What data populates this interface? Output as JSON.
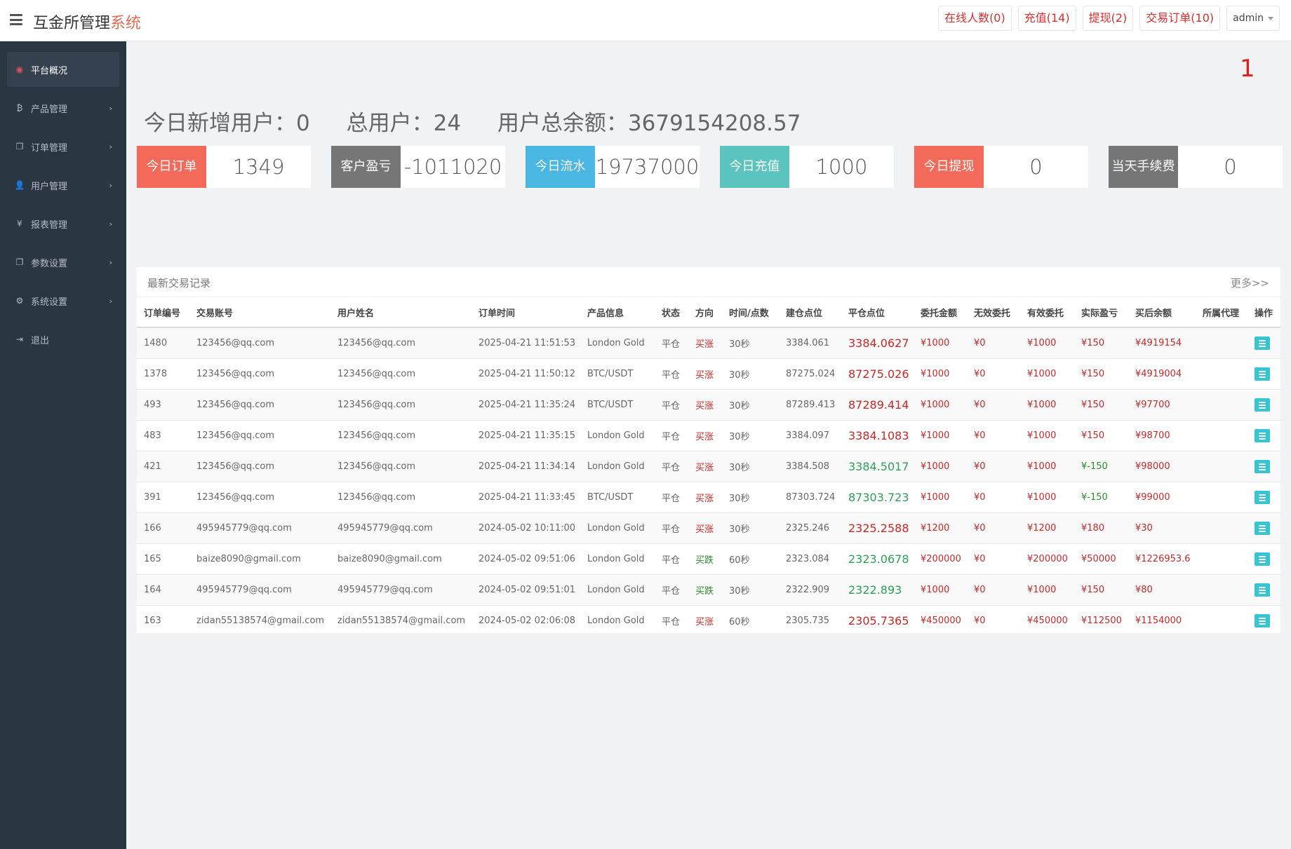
{
  "header": {
    "brand_main": "互金所管理",
    "brand_accent": "系统",
    "actions": [
      {
        "label": "在线人数(0)"
      },
      {
        "label": "充值(14)"
      },
      {
        "label": "提现(2)"
      },
      {
        "label": "交易订单(10)"
      }
    ],
    "user": "admin"
  },
  "sidebar": {
    "items": [
      {
        "label": "平台概况",
        "icon": "dashboard-icon",
        "glyph": "◉"
      },
      {
        "label": "产品管理",
        "icon": "bitcoin-icon",
        "glyph": "₿"
      },
      {
        "label": "订单管理",
        "icon": "copy-icon",
        "glyph": "❐"
      },
      {
        "label": "用户管理",
        "icon": "user-icon",
        "glyph": "👤"
      },
      {
        "label": "报表管理",
        "icon": "yen-icon",
        "glyph": "¥"
      },
      {
        "label": "参数设置",
        "icon": "copy-icon",
        "glyph": "❐"
      },
      {
        "label": "系统设置",
        "icon": "gears-icon",
        "glyph": "⚙"
      },
      {
        "label": "退出",
        "icon": "sign-out-icon",
        "glyph": "⇥"
      }
    ]
  },
  "badge_number": "1",
  "summary": {
    "new_users_label": "今日新增用户：",
    "new_users": "0",
    "total_users_label": "总用户：",
    "total_users": "24",
    "balance_label": "用户总余额：",
    "balance": "3679154208.57"
  },
  "stats": [
    {
      "label1": "今日",
      "label2": "订单",
      "value": "1349",
      "color": "#f36a5a"
    },
    {
      "label1": "客户",
      "label2": "盈亏",
      "value": "-1011020",
      "color": "#767676"
    },
    {
      "label1": "今日",
      "label2": "流水",
      "value": "19737000",
      "color": "#4ab6e2"
    },
    {
      "label1": "今日",
      "label2": "充值",
      "value": "1000",
      "color": "#5bc4bf"
    },
    {
      "label1": "今日",
      "label2": "提现",
      "value": "0",
      "color": "#f36a5a"
    },
    {
      "label1": "当天",
      "label2": "手续费",
      "value": "0",
      "color": "#767676"
    }
  ],
  "table": {
    "title": "最新交易记录",
    "more": "更多>>",
    "columns": [
      "订单编号",
      "交易账号",
      "用户姓名",
      "订单时间",
      "产品信息",
      "状态",
      "方向",
      "时间/点数",
      "建仓点位",
      "平仓点位",
      "委托金额",
      "无效委托",
      "有效委托",
      "实际盈亏",
      "买后余额",
      "所属代理",
      "操作"
    ],
    "rows": [
      {
        "id": "1480",
        "account": "123456@qq.com",
        "name": "123456@qq.com",
        "time": "2025-04-21 11:51:53",
        "product": "London Gold",
        "status": "平仓",
        "direction": "买涨",
        "duration": "30秒",
        "open": "3384.061",
        "close": "3384.0627",
        "amount": "¥1000",
        "invalid": "¥0",
        "valid": "¥1000",
        "pnl": "¥150",
        "balance": "¥4919154",
        "agent": ""
      },
      {
        "id": "1378",
        "account": "123456@qq.com",
        "name": "123456@qq.com",
        "time": "2025-04-21 11:50:12",
        "product": "BTC/USDT",
        "status": "平仓",
        "direction": "买涨",
        "duration": "30秒",
        "open": "87275.024",
        "close": "87275.026",
        "amount": "¥1000",
        "invalid": "¥0",
        "valid": "¥1000",
        "pnl": "¥150",
        "balance": "¥4919004",
        "agent": ""
      },
      {
        "id": "493",
        "account": "123456@qq.com",
        "name": "123456@qq.com",
        "time": "2025-04-21 11:35:24",
        "product": "BTC/USDT",
        "status": "平仓",
        "direction": "买涨",
        "duration": "30秒",
        "open": "87289.413",
        "close": "87289.414",
        "amount": "¥1000",
        "invalid": "¥0",
        "valid": "¥1000",
        "pnl": "¥150",
        "balance": "¥97700",
        "agent": ""
      },
      {
        "id": "483",
        "account": "123456@qq.com",
        "name": "123456@qq.com",
        "time": "2025-04-21 11:35:15",
        "product": "London Gold",
        "status": "平仓",
        "direction": "买涨",
        "duration": "30秒",
        "open": "3384.097",
        "close": "3384.1083",
        "amount": "¥1000",
        "invalid": "¥0",
        "valid": "¥1000",
        "pnl": "¥150",
        "balance": "¥98700",
        "agent": ""
      },
      {
        "id": "421",
        "account": "123456@qq.com",
        "name": "123456@qq.com",
        "time": "2025-04-21 11:34:14",
        "product": "London Gold",
        "status": "平仓",
        "direction": "买涨",
        "duration": "30秒",
        "open": "3384.508",
        "close": "3384.5017",
        "amount": "¥1000",
        "invalid": "¥0",
        "valid": "¥1000",
        "pnl": "¥-150",
        "balance": "¥98000",
        "agent": ""
      },
      {
        "id": "391",
        "account": "123456@qq.com",
        "name": "123456@qq.com",
        "time": "2025-04-21 11:33:45",
        "product": "BTC/USDT",
        "status": "平仓",
        "direction": "买涨",
        "duration": "30秒",
        "open": "87303.724",
        "close": "87303.723",
        "amount": "¥1000",
        "invalid": "¥0",
        "valid": "¥1000",
        "pnl": "¥-150",
        "balance": "¥99000",
        "agent": ""
      },
      {
        "id": "166",
        "account": "495945779@qq.com",
        "name": "495945779@qq.com",
        "time": "2024-05-02 10:11:00",
        "product": "London Gold",
        "status": "平仓",
        "direction": "买涨",
        "duration": "30秒",
        "open": "2325.246",
        "close": "2325.2588",
        "amount": "¥1200",
        "invalid": "¥0",
        "valid": "¥1200",
        "pnl": "¥180",
        "balance": "¥30",
        "agent": ""
      },
      {
        "id": "165",
        "account": "baize8090@gmail.com",
        "name": "baize8090@gmail.com",
        "time": "2024-05-02 09:51:06",
        "product": "London Gold",
        "status": "平仓",
        "direction": "买跌",
        "duration": "60秒",
        "open": "2323.084",
        "close": "2323.0678",
        "amount": "¥200000",
        "invalid": "¥0",
        "valid": "¥200000",
        "pnl": "¥50000",
        "balance": "¥1226953.6",
        "agent": ""
      },
      {
        "id": "164",
        "account": "495945779@qq.com",
        "name": "495945779@qq.com",
        "time": "2024-05-02 09:51:01",
        "product": "London Gold",
        "status": "平仓",
        "direction": "买跌",
        "duration": "30秒",
        "open": "2322.909",
        "close": "2322.893",
        "amount": "¥1000",
        "invalid": "¥0",
        "valid": "¥1000",
        "pnl": "¥150",
        "balance": "¥80",
        "agent": ""
      },
      {
        "id": "163",
        "account": "zidan55138574@gmail.com",
        "name": "zidan55138574@gmail.com",
        "time": "2024-05-02 02:06:08",
        "product": "London Gold",
        "status": "平仓",
        "direction": "买涨",
        "duration": "60秒",
        "open": "2305.735",
        "close": "2305.7365",
        "amount": "¥450000",
        "invalid": "¥0",
        "valid": "¥450000",
        "pnl": "¥112500",
        "balance": "¥1154000",
        "agent": ""
      }
    ]
  }
}
